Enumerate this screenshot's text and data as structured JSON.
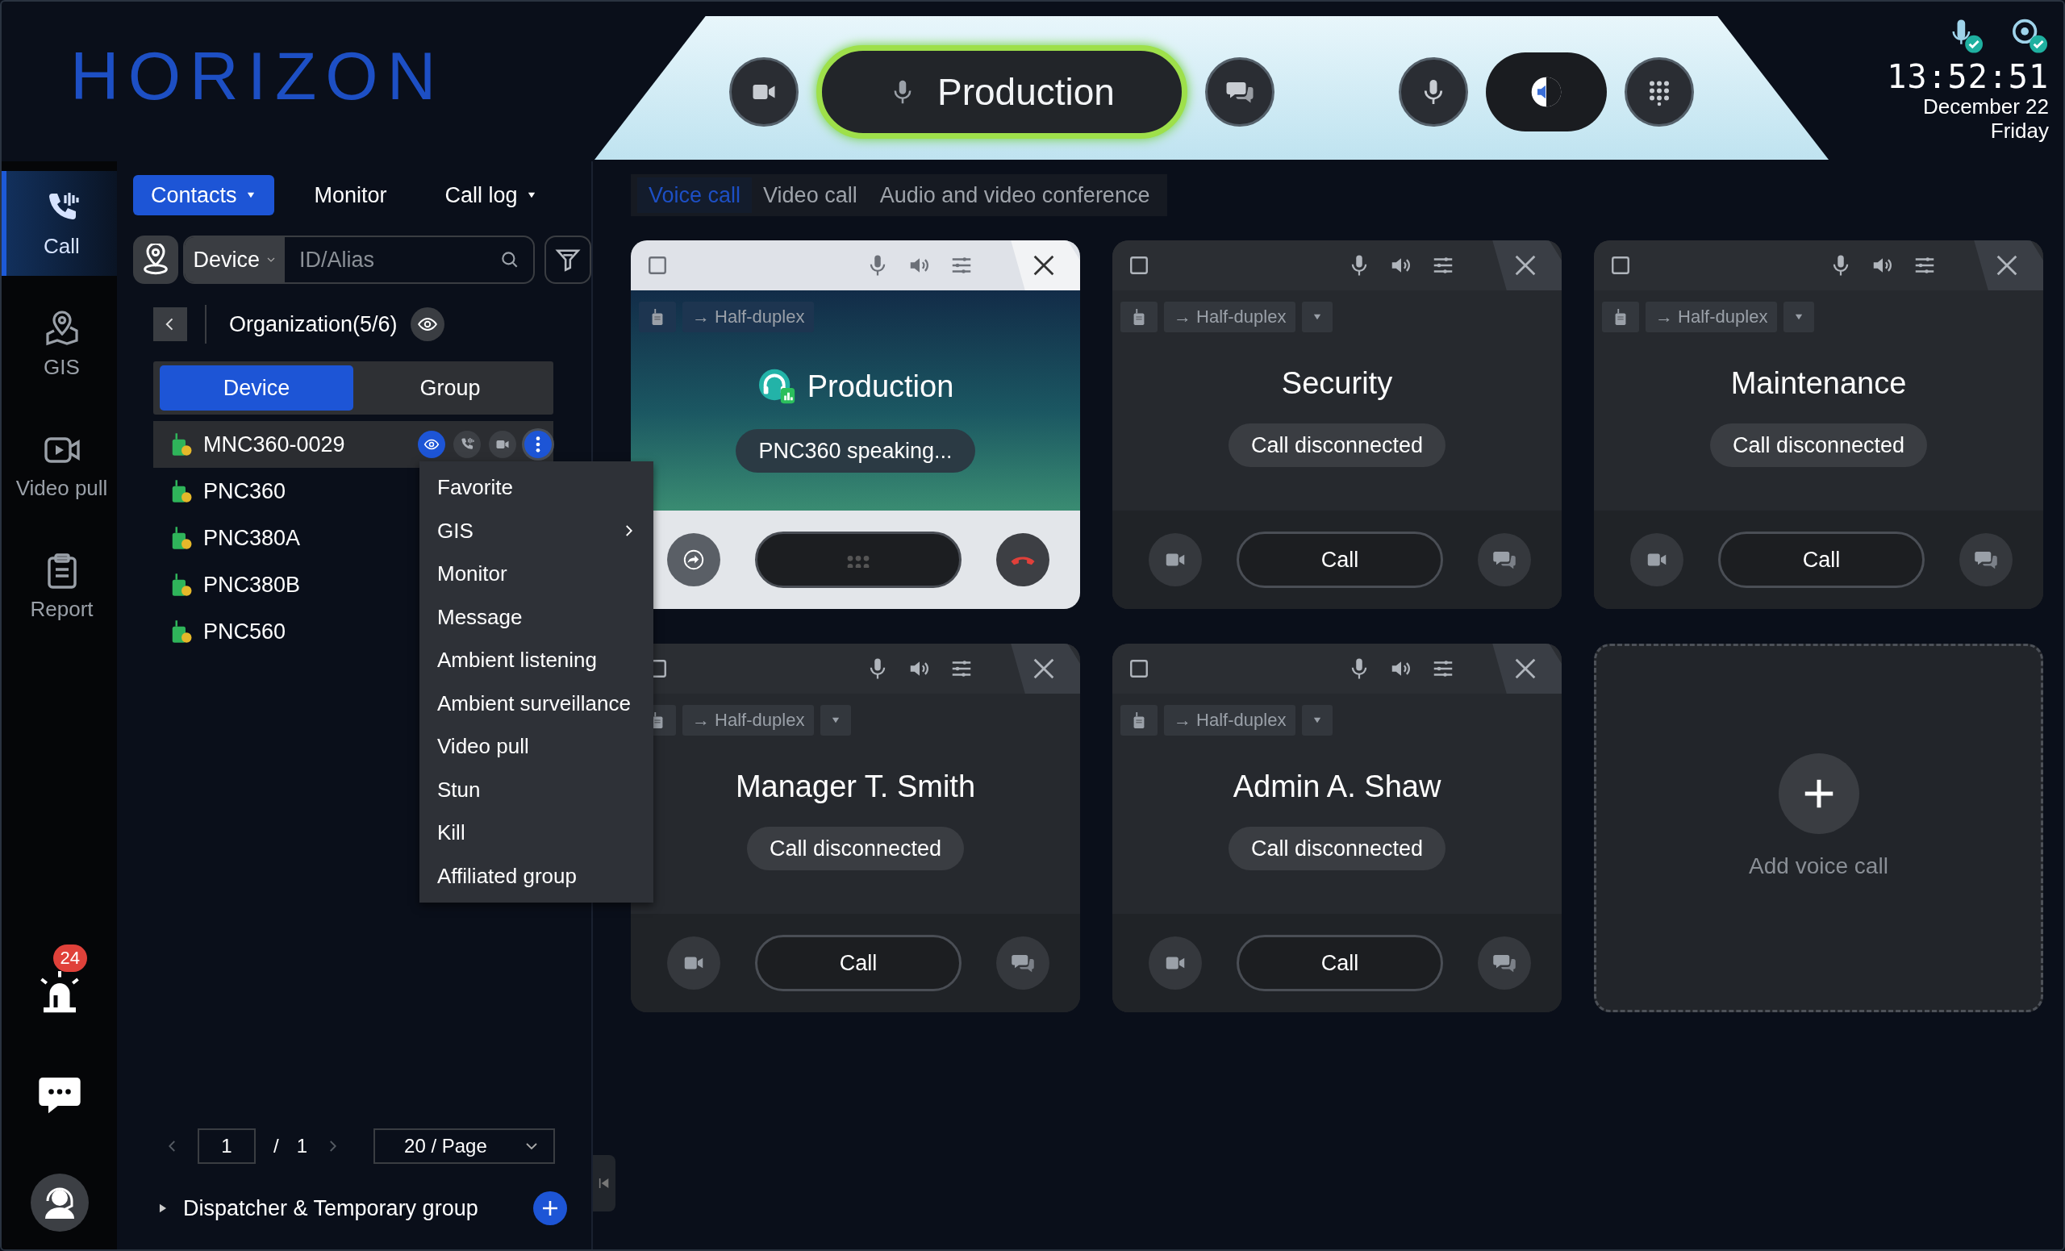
{
  "logo": "HORIZON",
  "top_bar": {
    "current_group": "Production",
    "clock": {
      "time": "13:52:51",
      "date": "December 22",
      "weekday": "Friday"
    }
  },
  "nav": {
    "items": [
      {
        "label": "Call",
        "selected": true
      },
      {
        "label": "GIS",
        "selected": false
      },
      {
        "label": "Video pull",
        "selected": false
      },
      {
        "label": "Report",
        "selected": false
      }
    ],
    "alarm_badge": "24"
  },
  "panel": {
    "tabs": [
      {
        "label": "Contacts",
        "dropdown": true,
        "selected": true
      },
      {
        "label": "Monitor",
        "dropdown": false,
        "selected": false
      },
      {
        "label": "Call log",
        "dropdown": true,
        "selected": false
      }
    ],
    "search": {
      "type": "Device",
      "placeholder": "ID/Alias"
    },
    "organization": "Organization(5/6)",
    "segments": [
      {
        "label": "Device",
        "selected": true
      },
      {
        "label": "Group",
        "selected": false
      }
    ],
    "devices": [
      {
        "name": "MNC360-0029",
        "selected": true
      },
      {
        "name": "PNC360",
        "selected": false
      },
      {
        "name": "PNC380A",
        "selected": false
      },
      {
        "name": "PNC380B",
        "selected": false
      },
      {
        "name": "PNC560",
        "selected": false
      }
    ],
    "context_menu": [
      {
        "label": "Favorite",
        "submenu": false
      },
      {
        "label": "GIS",
        "submenu": true
      },
      {
        "label": "Monitor",
        "submenu": false
      },
      {
        "label": "Message",
        "submenu": false
      },
      {
        "label": "Ambient listening",
        "submenu": false
      },
      {
        "label": "Ambient surveillance",
        "submenu": false
      },
      {
        "label": "Video pull",
        "submenu": false
      },
      {
        "label": "Stun",
        "submenu": false
      },
      {
        "label": "Kill",
        "submenu": false
      },
      {
        "label": "Affiliated group",
        "submenu": false
      }
    ],
    "pagination": {
      "page": "1",
      "separator": "/",
      "total": "1",
      "page_size": "20 / Page"
    },
    "dispatcher_group": "Dispatcher & Temporary group"
  },
  "call_tabs": [
    {
      "label": "Voice call",
      "selected": true
    },
    {
      "label": "Video call",
      "selected": false
    },
    {
      "label": "Audio and video conference",
      "selected": false
    }
  ],
  "calls": [
    {
      "kind": "call",
      "name": "Production",
      "mode": "→ Half-duplex",
      "status": "PNC360 speaking...",
      "active": true
    },
    {
      "kind": "call",
      "name": "Security",
      "mode": "→ Half-duplex",
      "status": "Call disconnected",
      "active": false,
      "action": "Call"
    },
    {
      "kind": "call",
      "name": "Maintenance",
      "mode": "→ Half-duplex",
      "status": "Call disconnected",
      "active": false,
      "action": "Call"
    },
    {
      "kind": "call",
      "name": "Manager T. Smith",
      "mode": "→ Half-duplex",
      "status": "Call disconnected",
      "active": false,
      "action": "Call"
    },
    {
      "kind": "call",
      "name": "Admin A. Shaw",
      "mode": "→ Half-duplex",
      "status": "Call disconnected",
      "active": false,
      "action": "Call"
    },
    {
      "kind": "add",
      "label": "Add voice call"
    }
  ]
}
